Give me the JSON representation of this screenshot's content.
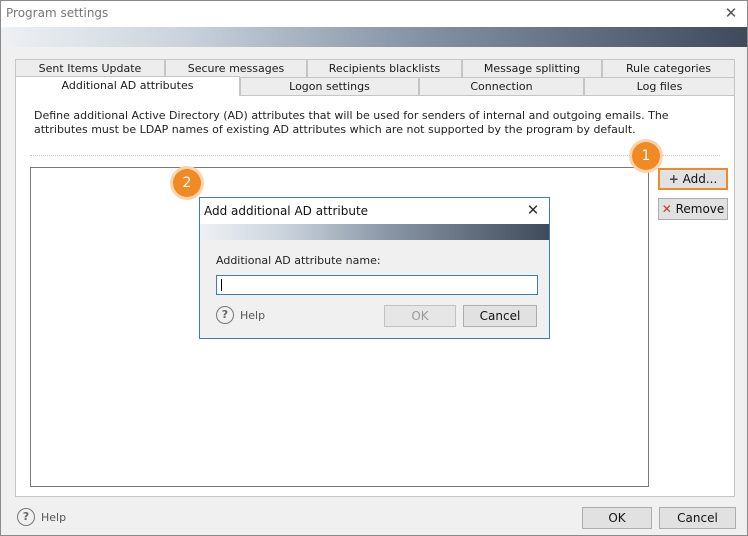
{
  "window": {
    "title": "Program settings"
  },
  "tabs_row1": [
    {
      "label": "Sent Items Update"
    },
    {
      "label": "Secure messages"
    },
    {
      "label": "Recipients blacklists"
    },
    {
      "label": "Message splitting"
    },
    {
      "label": "Rule categories"
    }
  ],
  "tabs_row2": [
    {
      "label": "Additional AD attributes",
      "active": true
    },
    {
      "label": "Logon settings"
    },
    {
      "label": "Connection"
    },
    {
      "label": "Log files"
    }
  ],
  "panel": {
    "description": "Define additional Active Directory (AD) attributes that will be used for senders of internal and outgoing emails. The attributes must be LDAP names of existing AD attributes which are not supported by the program by default.",
    "add_label": "Add...",
    "remove_label": "Remove"
  },
  "badges": [
    "1",
    "2"
  ],
  "dialog": {
    "title": "Add additional AD attribute",
    "field_label": "Additional AD attribute name:",
    "field_value": "",
    "help_label": "Help",
    "ok_label": "OK",
    "cancel_label": "Cancel"
  },
  "footer": {
    "help_label": "Help",
    "ok_label": "OK",
    "cancel_label": "Cancel"
  },
  "colors": {
    "accent": "#f08a24",
    "dialog_border": "#3c7fb1"
  },
  "icons": [
    "close-icon",
    "plus-icon",
    "remove-x-icon",
    "help-icon"
  ]
}
